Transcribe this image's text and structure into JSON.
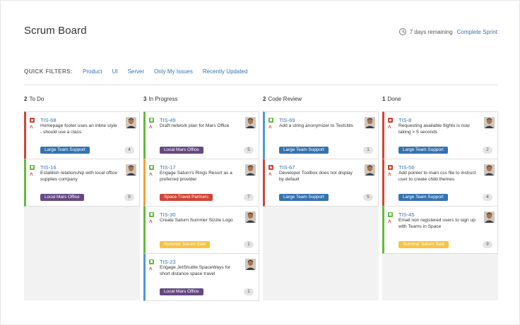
{
  "board": {
    "title": "Scrum Board"
  },
  "sprint": {
    "remaining": "7 days remaining",
    "complete_label": "Complete Sprint"
  },
  "quick_filters": {
    "label": "QUICK FILTERS:",
    "items": [
      "Product",
      "UI",
      "Server",
      "Only My Issues",
      "Recently Updated"
    ]
  },
  "columns": [
    {
      "count": "2",
      "name": "To Do"
    },
    {
      "count": "3",
      "name": "In Progress"
    },
    {
      "count": "2",
      "name": "Code Review"
    },
    {
      "count": "1",
      "name": "Done"
    }
  ],
  "cards": [
    {
      "col": 0,
      "key": "TIS-68",
      "type": "bug",
      "summary": "Homepage footer uses an inline style - should use a class",
      "label": "Large Team Support",
      "label_color": "#3572b0",
      "count": "4",
      "border": "#d04437"
    },
    {
      "col": 0,
      "key": "TIS-16",
      "type": "story",
      "summary": "Establish relationship with local office supplies company",
      "label": "Local Mars Office",
      "label_color": "#654982",
      "count": "9",
      "border": "#63ba3c"
    },
    {
      "col": 1,
      "key": "TIS-49",
      "type": "story",
      "summary": "Draft network plan for Mars Office",
      "label": "Local Mars Office",
      "label_color": "#654982",
      "count": "5",
      "border": "#63ba3c"
    },
    {
      "col": 1,
      "key": "TIS-17",
      "type": "story",
      "summary": "Engage Saturn's Rings Resort as a preferred provider",
      "label": "Space Travel Partners",
      "label_color": "#d04437",
      "count": "7",
      "border": "#f6a032"
    },
    {
      "col": 1,
      "key": "TIS-30",
      "type": "story",
      "summary": "Create Saturn Summer Sizzle Logo",
      "label": "Summer Saturn Sale",
      "label_color": "#f6c342",
      "count": "1",
      "border": "#63ba3c"
    },
    {
      "col": 1,
      "key": "TIS-23",
      "type": "story",
      "summary": "Engage JetShuttle SpaceWays for short distance space travel",
      "label": "Local Mars Office",
      "label_color": "#654982",
      "count": "1",
      "border": "#4a9ad4"
    },
    {
      "col": 2,
      "key": "TIS-69",
      "type": "story",
      "summary": "Add a string anonymizer to TextUtils",
      "label": "Large Team Support",
      "label_color": "#3572b0",
      "count": "1",
      "border": "#4a9ad4"
    },
    {
      "col": 2,
      "key": "TIS-67",
      "type": "bug",
      "summary": "Developer Toolbox does not display by default",
      "label": "Large Team Support",
      "label_color": "#3572b0",
      "count": "5",
      "border": "#d04437"
    },
    {
      "col": 3,
      "key": "TIS-8",
      "type": "bug",
      "summary": "Requesting available flights is now taking > 5 seconds",
      "label": "Large Team Support",
      "label_color": "#3572b0",
      "count": "2",
      "border": "#d04437"
    },
    {
      "col": 3,
      "key": "TIS-56",
      "type": "bug",
      "summary": "Add pointer to main css file to instruct user to create child themes",
      "label": "Large Team Support",
      "label_color": "#3572b0",
      "count": "4",
      "border": "#d04437"
    },
    {
      "col": 3,
      "key": "TIS-45",
      "type": "story",
      "summary": "Email non registered users to sign up with Teams in Space",
      "label": "Summer Saturn Sale",
      "label_color": "#f6c342",
      "count": "9",
      "border": "#63ba3c"
    }
  ]
}
